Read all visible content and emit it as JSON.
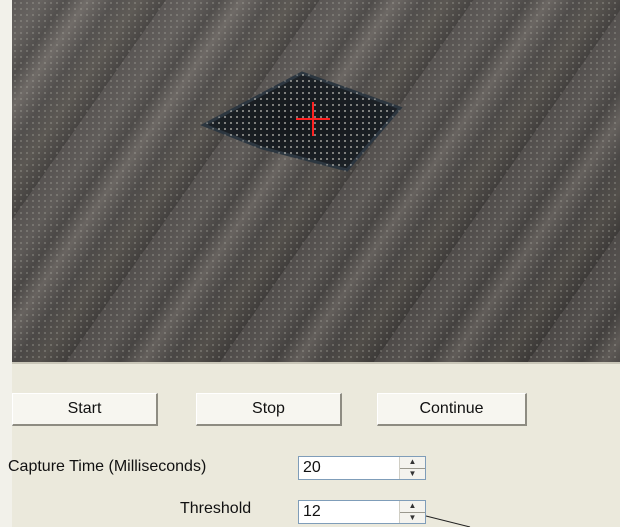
{
  "video": {
    "target_marker_icon": "crosshair-icon",
    "marker_color": "#ff2020"
  },
  "controls": {
    "start_label": "Start",
    "stop_label": "Stop",
    "continue_label": "Continue"
  },
  "settings": {
    "capture_time_label": "Capture Time (Milliseconds)",
    "capture_time_value": "20",
    "threshold_label": "Threshold",
    "threshold_value": "12"
  }
}
